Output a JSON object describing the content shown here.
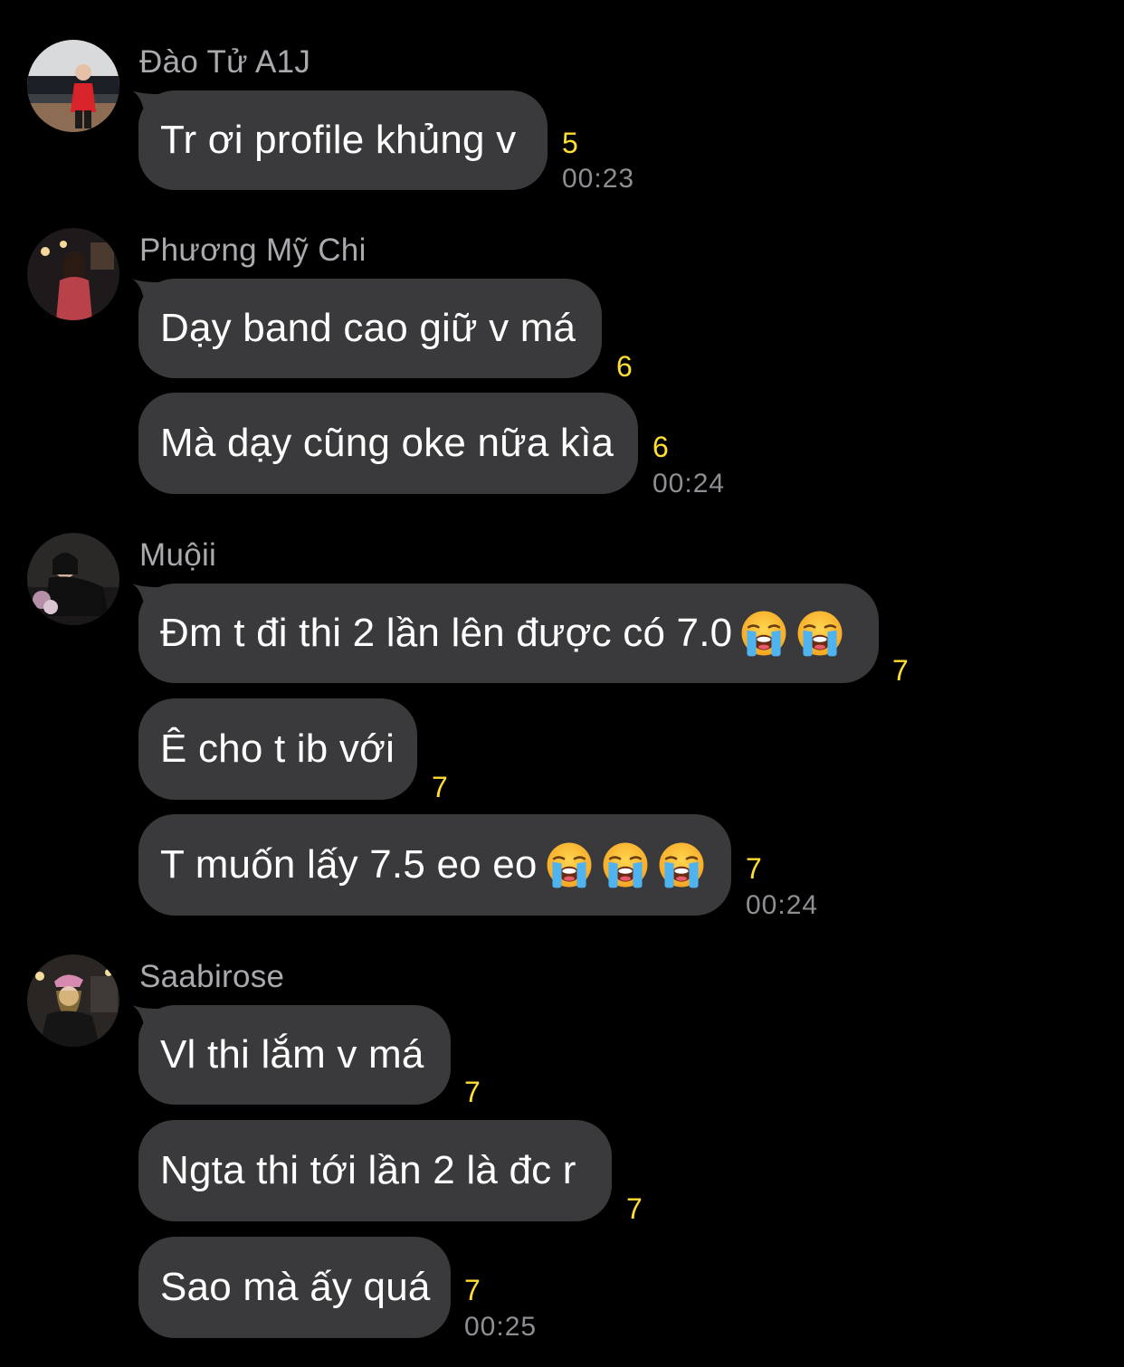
{
  "groups": [
    {
      "sender": "Đào Tử A1J",
      "messages": [
        {
          "text": "Tr ơi profile khủng v",
          "count": "5",
          "time": "00:23"
        }
      ]
    },
    {
      "sender": "Phương Mỹ Chi",
      "messages": [
        {
          "text": "Dạy band cao giữ v má",
          "count": "6"
        },
        {
          "text": "Mà dạy cũng oke nữa kìa",
          "count": "6",
          "time": "00:24"
        }
      ]
    },
    {
      "sender": "Muộii",
      "messages": [
        {
          "text": "Đm t đi thi 2 lần lên được có 7.0",
          "emojis": [
            "loudly-crying-face",
            "loudly-crying-face"
          ],
          "count": "7"
        },
        {
          "text": "Ê cho t ib với",
          "count": "7"
        },
        {
          "text": "T muốn lấy 7.5 eo eo",
          "emojis": [
            "loudly-crying-face",
            "loudly-crying-face",
            "loudly-crying-face"
          ],
          "count": "7",
          "time": "00:24"
        }
      ]
    },
    {
      "sender": "Saabirose",
      "messages": [
        {
          "text": "Vl thi lắm v má",
          "count": "7"
        },
        {
          "text": "Ngta thi tới lần 2 là đc r",
          "count": "7"
        },
        {
          "text": "Sao mà ấy quá",
          "count": "7",
          "time": "00:25"
        }
      ]
    }
  ],
  "colors": {
    "background": "#000000",
    "bubble": "#3a3a3c",
    "sender": "#a9a9ae",
    "reaction_count": "#ffdd33",
    "timestamp": "#8e8e93"
  }
}
